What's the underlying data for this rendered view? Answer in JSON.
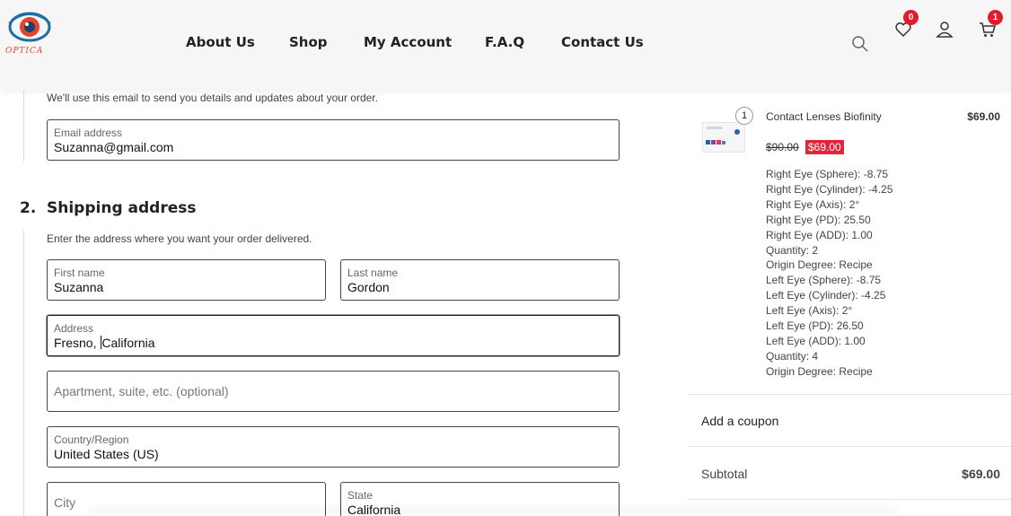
{
  "header": {
    "logo_text": "OPTICA",
    "nav": [
      "About Us",
      "Shop",
      "My Account",
      "F.A.Q",
      "Contact Us"
    ],
    "wishlist_count": "0",
    "cart_count": "1"
  },
  "contact": {
    "hint": "We'll use this email to send you details and updates about your order.",
    "email_label": "Email address",
    "email_value": "Suzanna@gmail.com"
  },
  "shipping": {
    "number": "2.",
    "title": "Shipping address",
    "hint": "Enter the address where you want your order delivered.",
    "first_name_label": "First name",
    "first_name_value": "Suzanna",
    "last_name_label": "Last name",
    "last_name_value": "Gordon",
    "address_label": "Address",
    "address_value_a": "Fresno, ",
    "address_value_b": "California",
    "apartment_placeholder": "Apartment, suite, etc. (optional)",
    "country_label": "Country/Region",
    "country_value": "United States (US)",
    "city_placeholder": "City",
    "state_label": "State",
    "state_value": "California"
  },
  "order": {
    "item_qty": "1",
    "item_name": "Contact Lenses Biofinity",
    "item_price": "$69.00",
    "old_price": "$90.00",
    "sale_price": "$69.00",
    "specs": [
      "Right Eye (Sphere): -8.75",
      "Right Eye (Cylinder): -4.25",
      "Right Eye (Axis): 2°",
      "Right Eye (PD): 25.50",
      "Right Eye (ADD): 1.00",
      "Quantity: 2",
      "Origin Degree: Recipe",
      "Left Eye (Sphere): -8.75",
      "Left Eye (Cylinder): -4.25",
      "Left Eye (Axis): 2°",
      "Left Eye (PD): 26.50",
      "Left Eye (ADD): 1.00",
      "Quantity: 4",
      "Origin Degree: Recipe"
    ],
    "coupon_label": "Add a coupon",
    "subtotal_label": "Subtotal",
    "subtotal_value": "$69.00"
  },
  "colors": {
    "accent_red": "#e4243a",
    "badge_red": "#e11d2b",
    "logo_orange": "#e5462b",
    "logo_blue": "#1f6fa5"
  },
  "icons": [
    "logo-eye-icon",
    "search-icon",
    "heart-icon",
    "user-icon",
    "cart-icon"
  ]
}
